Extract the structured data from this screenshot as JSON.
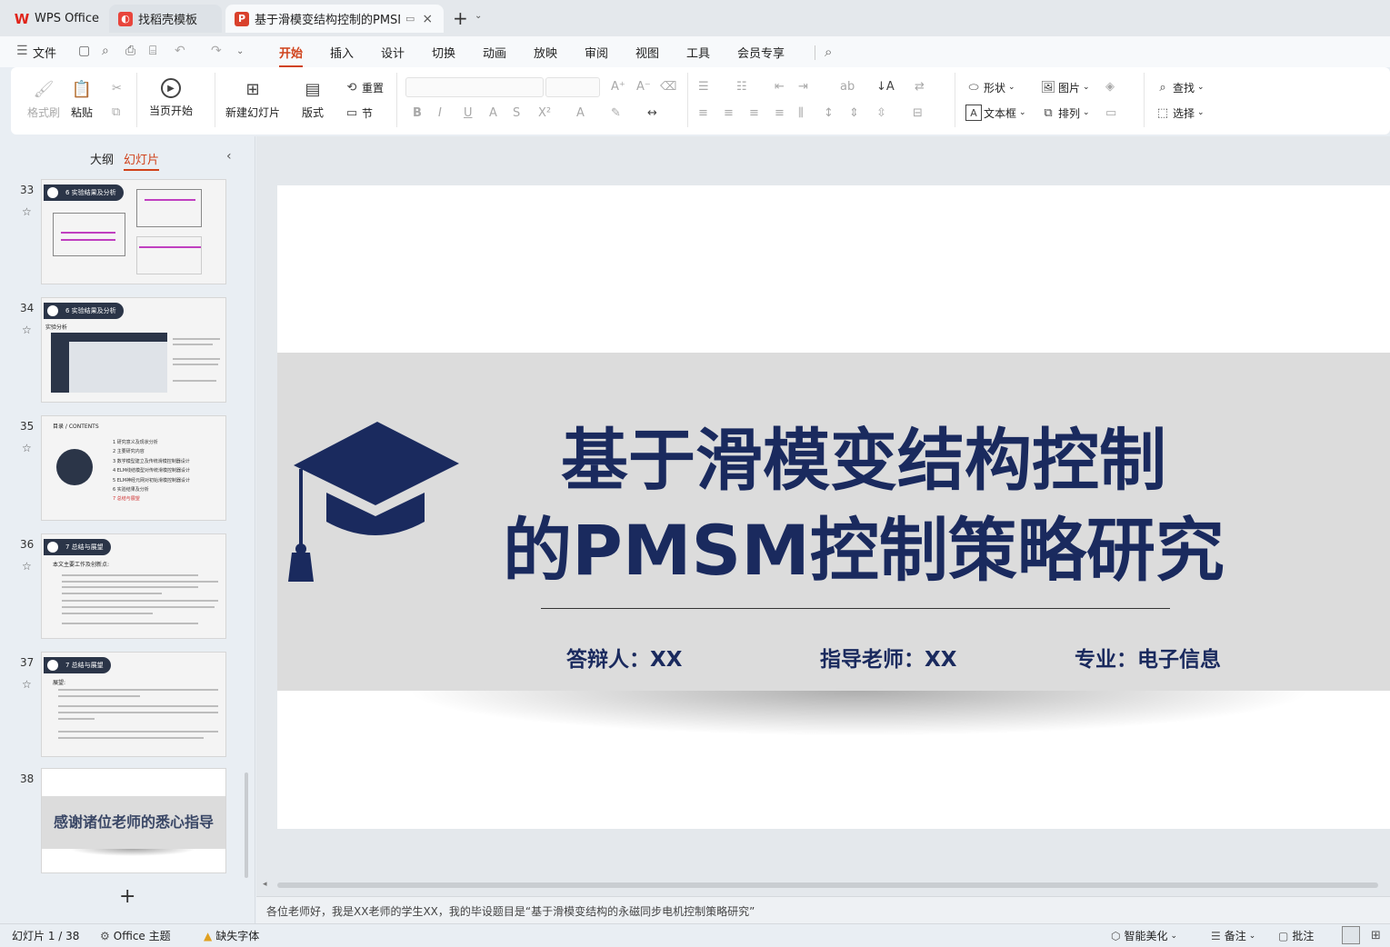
{
  "tabs": [
    {
      "label": "WPS Office",
      "icon": "wps-logo-icon"
    },
    {
      "label": "找稻壳模板",
      "icon": "docer-icon"
    },
    {
      "label": "基于滑模变结构控制的PMSM",
      "icon": "ppt-icon"
    }
  ],
  "menu": {
    "file_label": "文件",
    "items": [
      "开始",
      "插入",
      "设计",
      "切换",
      "动画",
      "放映",
      "审阅",
      "视图",
      "工具",
      "会员专享"
    ]
  },
  "ribbon": {
    "format_painter": "格式刷",
    "paste": "粘贴",
    "play_from_start": "当页开始",
    "new_slide": "新建幻灯片",
    "layout": "版式",
    "reset": "重置",
    "section": "节",
    "shape": "形状",
    "picture": "图片",
    "textbox": "文本框",
    "arrange": "排列",
    "find": "查找",
    "select": "选择"
  },
  "panel": {
    "outline_tab": "大纲",
    "slides_tab": "幻灯片",
    "add_symbol": "+"
  },
  "thumbnails": [
    {
      "number": "33",
      "badge": "6 实验结果及分析"
    },
    {
      "number": "34",
      "badge": "6 实验结果及分析",
      "subtitle": "实验分析"
    },
    {
      "number": "35",
      "heading": "目录 / CONTENTS",
      "items": [
        "1 研究意义及现状分析",
        "2 主要研究内容",
        "3 数学模型建立及传统滑模控制器设计",
        "4 ELM线结模型对传统滑模控制器设计",
        "5 ELM神经元网对初始滑模控制器设计",
        "6 实验结果及分析",
        "7 总结与展望"
      ]
    },
    {
      "number": "36",
      "badge": "7 总结与展望",
      "subtitle": "本文主要工作及创新点:"
    },
    {
      "number": "37",
      "badge": "7 总结与展望",
      "subtitle": "展望:"
    },
    {
      "number": "38",
      "text": "感谢诸位老师的悉心指导"
    }
  ],
  "slide": {
    "title_line1": "基于滑模变结构控制",
    "title_line2": "的PMSM控制策略研究",
    "defender": "答辩人：XX",
    "advisor": "指导老师：XX",
    "major": "专业：电子信息"
  },
  "notes": "各位老师好，我是XX老师的学生XX，我的毕设题目是“基于滑模变结构的永磁同步电机控制策略研究”",
  "status": {
    "slide_counter": "幻灯片 1 / 38",
    "theme": "Office 主题",
    "missing_fonts": "缺失字体",
    "smart_beautify": "智能美化",
    "notes_btn": "备注",
    "comments_btn": "批注"
  },
  "colors": {
    "accent": "#d0421b",
    "slide_title": "#1a2a5e",
    "band": "#dcdcdc"
  }
}
